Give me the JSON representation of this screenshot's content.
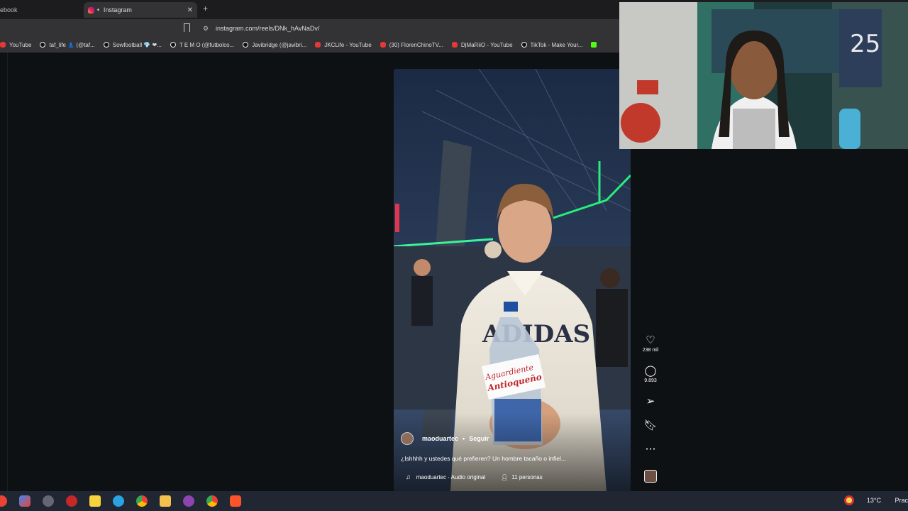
{
  "browser": {
    "prev_tab_label": "ebook",
    "active_tab_label": "Instagram",
    "url": "instagram.com/reels/DNk_hAvNaDv/"
  },
  "bookmarks": [
    {
      "label": "YouTube",
      "icon": "youtube-icon"
    },
    {
      "label": "taf_life 👗 (@taf...",
      "icon": "tiktok-icon"
    },
    {
      "label": "Sowfootball 💎 ❤...",
      "icon": "tiktok-icon"
    },
    {
      "label": "T E M O (@futbolco...",
      "icon": "tiktok-icon"
    },
    {
      "label": "Javibridge (@javibri...",
      "icon": "tiktok-icon"
    },
    {
      "label": "JKCLife - YouTube",
      "icon": "youtube-icon"
    },
    {
      "label": "(30) FlorenChinoTV...",
      "icon": "youtube-icon"
    },
    {
      "label": "DjMaRiiO - YouTube",
      "icon": "youtube-icon"
    },
    {
      "label": "TikTok - Make Your...",
      "icon": "tiktok-icon"
    },
    {
      "label": "",
      "icon": "kick-icon"
    }
  ],
  "reel": {
    "author": "maoduartec",
    "separator": "•",
    "follow_label": "Seguir",
    "caption": "¿Ishhhh y ustedes qué prefieren? Un hombre tacaño o infiel...",
    "audio_label": "maoduartec · Audio original",
    "people_label": "11 personas",
    "bottle_label_line1": "Aguardiente",
    "bottle_label_line2": "Antioqueño",
    "sweater_text": "ADIDAS"
  },
  "actions": {
    "likes": "238 mil",
    "comments": "9.893"
  },
  "taskbar": {
    "weather": "13°C",
    "tray_text": "Prac"
  },
  "colors": {
    "page_bg": "#0d1114",
    "chrome_bar": "#333336",
    "taskbar": "#202733"
  }
}
